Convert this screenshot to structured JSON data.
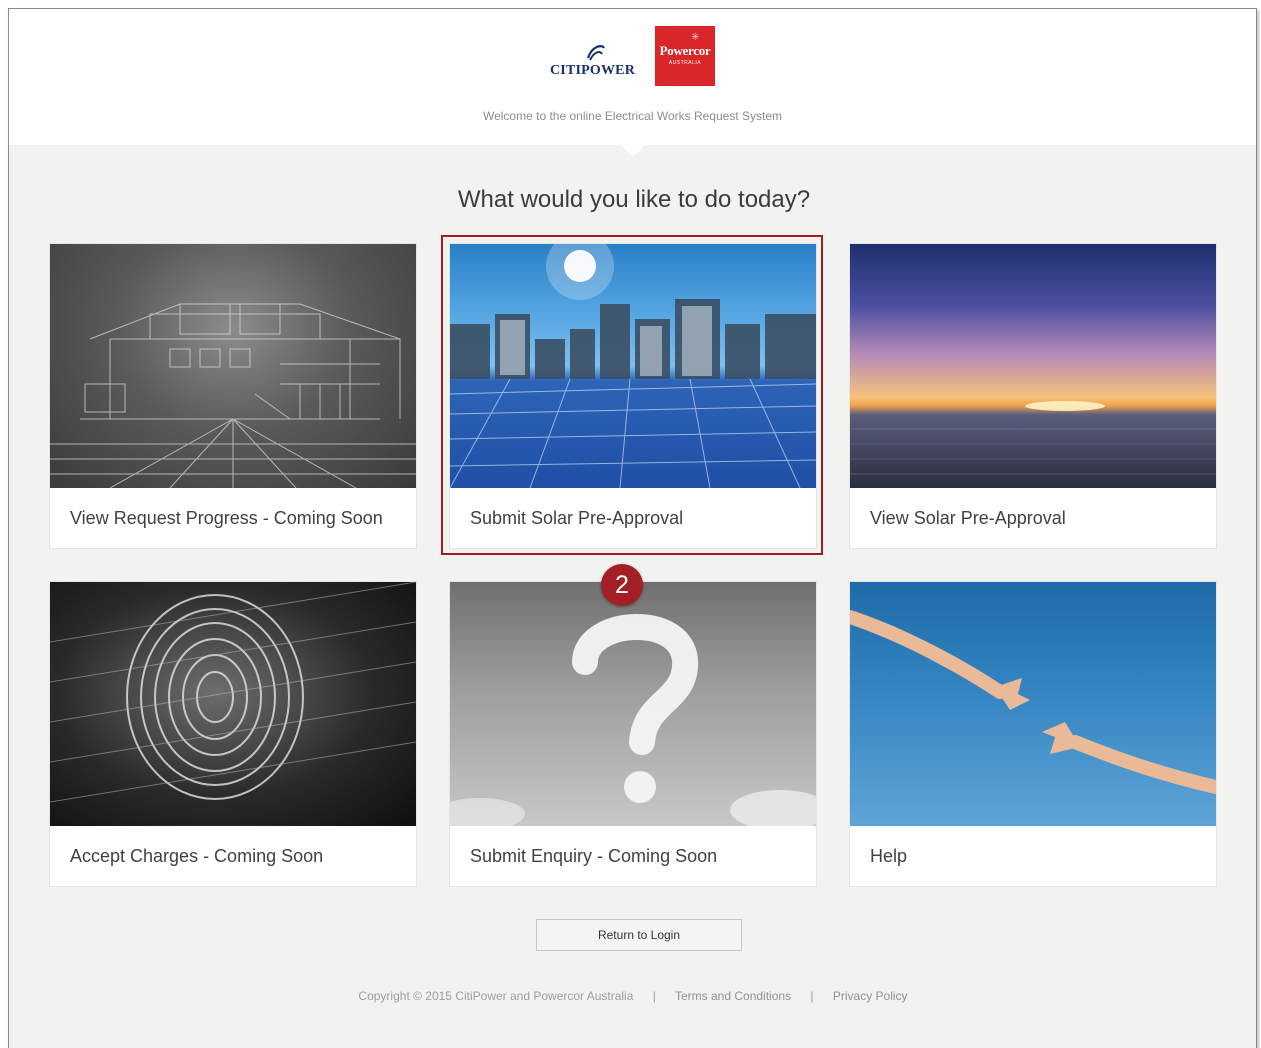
{
  "header": {
    "logo_citipower_text": "CITIPOWER",
    "logo_powercor_text": "Powercor",
    "logo_powercor_sub": "AUSTRALIA",
    "welcome": "Welcome to the online Electrical Works Request System"
  },
  "main": {
    "question": "What would you like to do today?",
    "tiles": [
      {
        "label": "View Request Progress - Coming Soon",
        "image": "wireframe-house"
      },
      {
        "label": "Submit Solar Pre-Approval",
        "image": "solar-panels-city"
      },
      {
        "label": "View Solar Pre-Approval",
        "image": "sunset-sea"
      },
      {
        "label": "Accept Charges - Coming Soon",
        "image": "fingerprint"
      },
      {
        "label": "Submit Enquiry - Coming Soon",
        "image": "cloud-question-mark"
      },
      {
        "label": "Help",
        "image": "reaching-hands"
      }
    ],
    "highlight_color": "#a11d24",
    "step_badge": "2"
  },
  "actions": {
    "return_label": "Return to Login"
  },
  "footer": {
    "copyright": "Copyright © 2015 CitiPower and Powercor Australia",
    "separator": "|",
    "terms": "Terms and Conditions",
    "privacy": "Privacy Policy"
  }
}
